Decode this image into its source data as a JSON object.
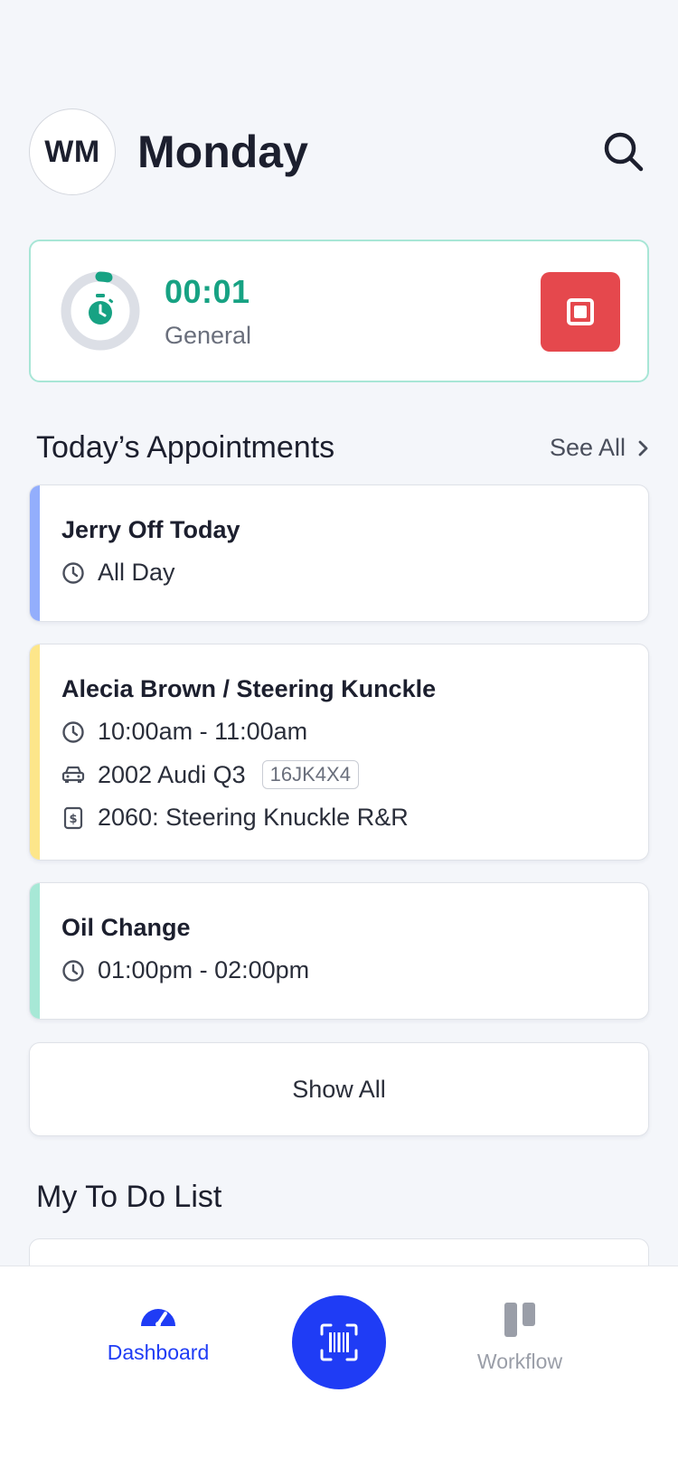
{
  "header": {
    "avatar_initials": "WM",
    "day": "Monday",
    "search_icon": "search-icon"
  },
  "timer": {
    "value": "00:01",
    "label": "General",
    "icon": "stopwatch-icon",
    "stop_icon": "stop-icon",
    "accent": "#17a283",
    "stop_color": "#e5484d"
  },
  "appointments_section": {
    "title": "Today’s Appointments",
    "see_all": "See All"
  },
  "appointments": [
    {
      "title": "Jerry Off Today",
      "time": "All Day",
      "color": "#93aefc"
    },
    {
      "title": "Alecia Brown / Steering Kunckle",
      "time": "10:00am - 11:00am",
      "vehicle": "2002 Audi Q3",
      "plate": "16JK4X4",
      "job": "2060: Steering Knuckle R&R",
      "color": "#fde68a"
    },
    {
      "title": "Oil Change",
      "time": "01:00pm - 02:00pm",
      "color": "#a7e8d6"
    }
  ],
  "show_all": "Show All",
  "todo_section": {
    "title": "My To Do List"
  },
  "bottom_nav": {
    "dashboard": "Dashboard",
    "workflow": "Workflow",
    "active_color": "#1f3cf5",
    "inactive_color": "#9a9ea8"
  }
}
